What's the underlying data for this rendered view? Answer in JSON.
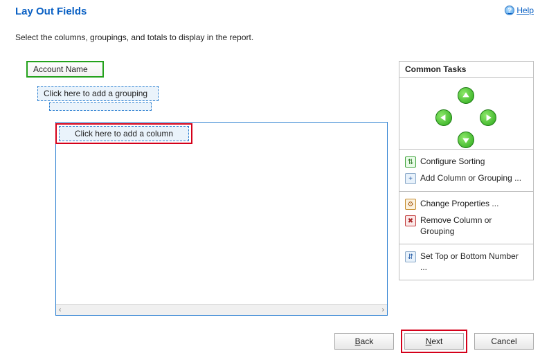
{
  "header": {
    "title": "Lay Out Fields",
    "help_label": "Help"
  },
  "instruction": "Select the columns, groupings, and totals to display in the report.",
  "field_layout": {
    "account_chip": "Account Name",
    "add_grouping": "Click here to add a grouping",
    "add_column": "Click here to add a column"
  },
  "tasks": {
    "heading": "Common Tasks",
    "configure_sorting": "Configure Sorting",
    "add_column_grouping": "Add Column or Grouping ...",
    "change_properties": "Change Properties ...",
    "remove_column_grouping": "Remove Column or Grouping",
    "set_top_bottom": "Set Top or Bottom Number ..."
  },
  "buttons": {
    "back": "Back",
    "next": "Next",
    "cancel": "Cancel"
  }
}
